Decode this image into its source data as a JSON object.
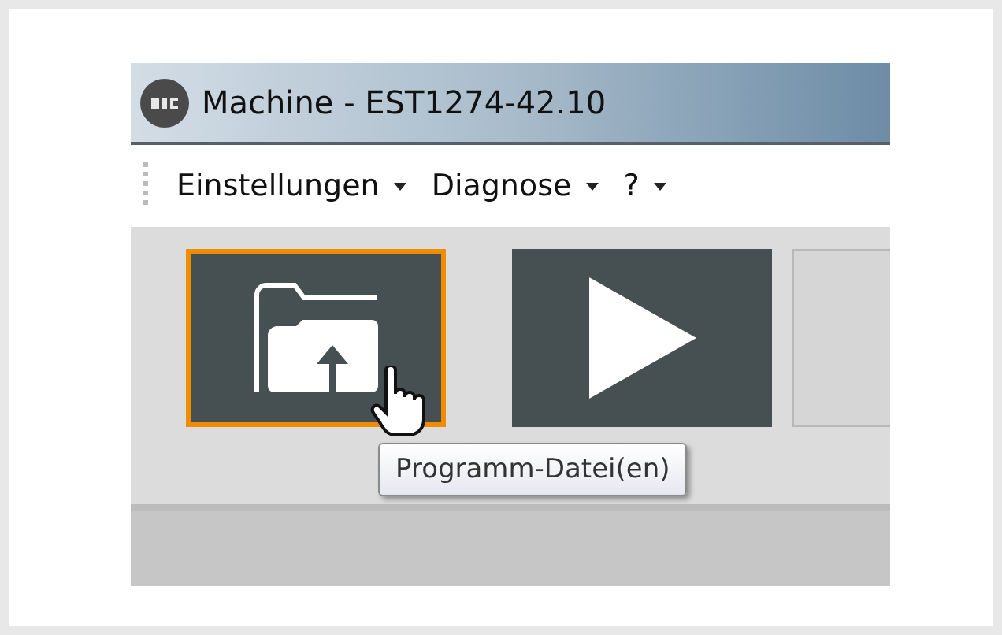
{
  "window": {
    "title": "Machine - EST1274-42.10"
  },
  "menu": [
    {
      "label": "Einstellungen",
      "has_dropdown": true
    },
    {
      "label": "Diagnose",
      "has_dropdown": true
    },
    {
      "label": "?",
      "has_dropdown": true
    }
  ],
  "toolbar": [
    {
      "kind": "folder-upload",
      "selected": true
    },
    {
      "kind": "play",
      "selected": false
    },
    {
      "kind": "blank",
      "selected": false
    }
  ],
  "tooltip": "Programm-Datei(en)"
}
